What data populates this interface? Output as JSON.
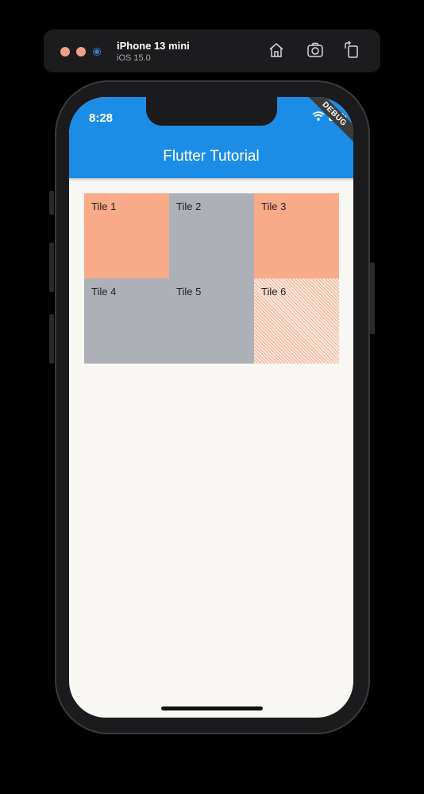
{
  "simulator": {
    "device_name": "iPhone 13 mini",
    "os_version": "iOS 15.0",
    "icons": [
      "home-icon",
      "screenshot-icon",
      "rotate-icon"
    ]
  },
  "status_bar": {
    "time": "8:28",
    "icons": [
      "wifi-icon",
      "battery-icon"
    ],
    "debug_banner": "DEBUG"
  },
  "app_bar": {
    "title": "Flutter Tutorial",
    "color": "#1c8de6"
  },
  "grid": {
    "tiles": [
      {
        "label": "Tile 1",
        "color": "#f9aa88"
      },
      {
        "label": "Tile 2",
        "color": "#aeb0b8"
      },
      {
        "label": "Tile 3",
        "color": "#f9aa88"
      },
      {
        "label": "Tile 4",
        "color": "#aeb0b8"
      },
      {
        "label": "Tile 5",
        "color": "#aeb0b8"
      },
      {
        "label": "Tile 6",
        "color": "#f4c9b6"
      }
    ]
  }
}
